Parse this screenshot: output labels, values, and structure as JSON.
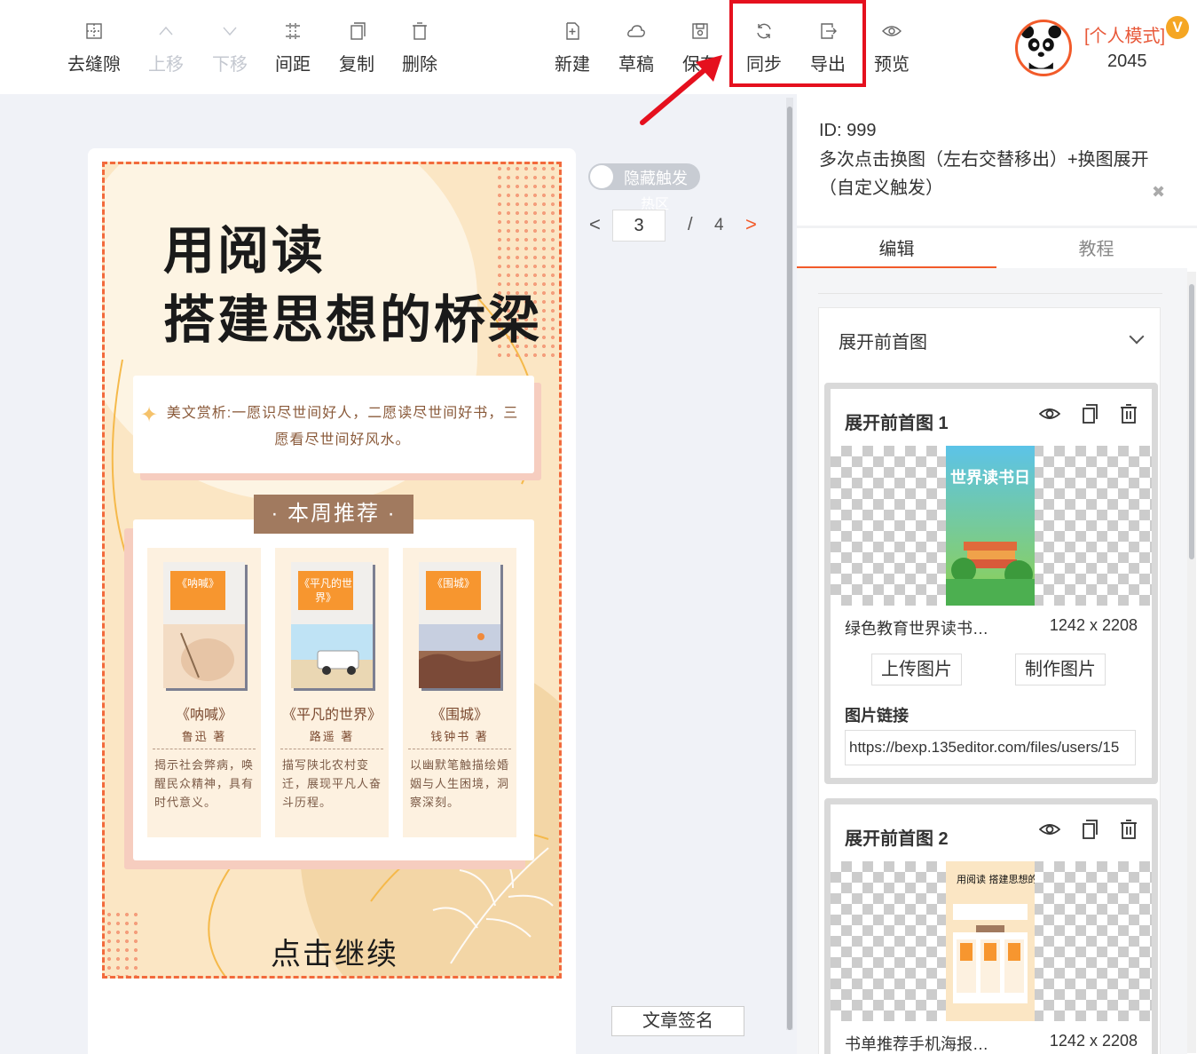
{
  "toolbar": {
    "left_buttons": [
      {
        "label": "去缝隙",
        "icon": "remove-gap-icon",
        "disabled": false
      },
      {
        "label": "上移",
        "icon": "chevron-up-icon",
        "disabled": true
      },
      {
        "label": "下移",
        "icon": "chevron-down-icon",
        "disabled": true
      },
      {
        "label": "间距",
        "icon": "spacing-icon",
        "disabled": false
      },
      {
        "label": "复制",
        "icon": "copy-icon",
        "disabled": false
      },
      {
        "label": "删除",
        "icon": "trash-icon",
        "disabled": false
      }
    ],
    "right_buttons": [
      {
        "label": "新建",
        "icon": "new-file-icon"
      },
      {
        "label": "草稿",
        "icon": "cloud-icon"
      },
      {
        "label": "保存",
        "icon": "save-icon"
      },
      {
        "label": "同步",
        "icon": "sync-icon"
      },
      {
        "label": "导出",
        "icon": "export-icon"
      },
      {
        "label": "预览",
        "icon": "eye-icon"
      }
    ]
  },
  "user": {
    "mode_label": "[个人模式]",
    "badge": "V",
    "number": "2045"
  },
  "poster": {
    "title_line1": "用阅读",
    "title_line2": "搭建思想的桥梁",
    "quote": "美文赏析:一愿识尽世间好人，二愿读尽世间好书，三愿看尽世间好风水。",
    "week_badge": "· 本周推荐 ·",
    "books": [
      {
        "tag": "《呐喊》",
        "name": "《呐喊》",
        "author": "鲁迅 著",
        "desc": "揭示社会弊病，唤醒民众精神，具有时代意义。"
      },
      {
        "tag": "《平凡的世界》",
        "name": "《平凡的世界》",
        "author": "路遥 著",
        "desc": "描写陕北农村变迁，展现平凡人奋斗历程。"
      },
      {
        "tag": "《围城》",
        "name": "《围城》",
        "author": "钱钟书 著",
        "desc": "以幽默笔触描绘婚姻与人生困境，洞察深刻。"
      }
    ],
    "cta": "点击继续"
  },
  "canvas": {
    "toggle_label": "隐藏触发",
    "toggle_sub": "热区",
    "page_current": "3",
    "page_slash": "/",
    "page_total": "4",
    "sign_button": "文章签名"
  },
  "panel": {
    "id_text": "ID: 999",
    "description": "多次点击换图（左右交替移出）+换图展开（自定义触发）",
    "tabs": [
      "编辑",
      "教程"
    ],
    "section_title": "展开前首图",
    "cards": [
      {
        "title": "展开前首图 1",
        "filename": "绿色教育世界读书…",
        "size": "1242 x 2208",
        "thumb_title": "世界读书日",
        "upload_label": "上传图片",
        "make_label": "制作图片",
        "link_label": "图片链接",
        "link_value": "https://bexp.135editor.com/files/users/15"
      },
      {
        "title": "展开前首图 2",
        "filename": "书单推荐手机海报…",
        "size": "1242 x 2208",
        "thumb_title": "用阅读 搭建思想的桥梁"
      }
    ]
  }
}
